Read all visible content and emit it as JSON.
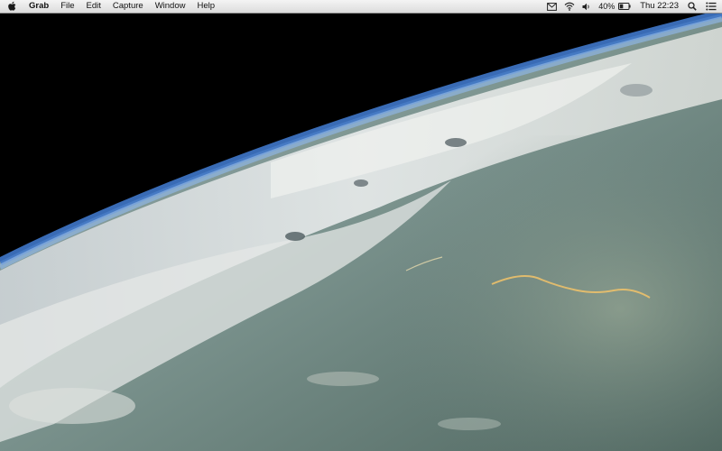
{
  "menubar": {
    "app_name": "Grab",
    "menus": [
      "File",
      "Edit",
      "Capture",
      "Window",
      "Help"
    ],
    "status": {
      "battery_percent": "40%",
      "battery_level": 0.4,
      "clock": "Thu 22:23"
    },
    "icons": [
      "apple-logo",
      "mail-icon",
      "wifi-icon",
      "volume-icon",
      "battery-icon",
      "spotlight-icon",
      "notification-center-icon"
    ]
  },
  "wallpaper": {
    "subject": "earth-from-orbit"
  },
  "colors": {
    "menubar_bg": "#e6e6e6",
    "space": "#000000",
    "atmosphere": "#4a7fc8",
    "clouds": "#dfe4e6",
    "land": "#6f8680"
  }
}
